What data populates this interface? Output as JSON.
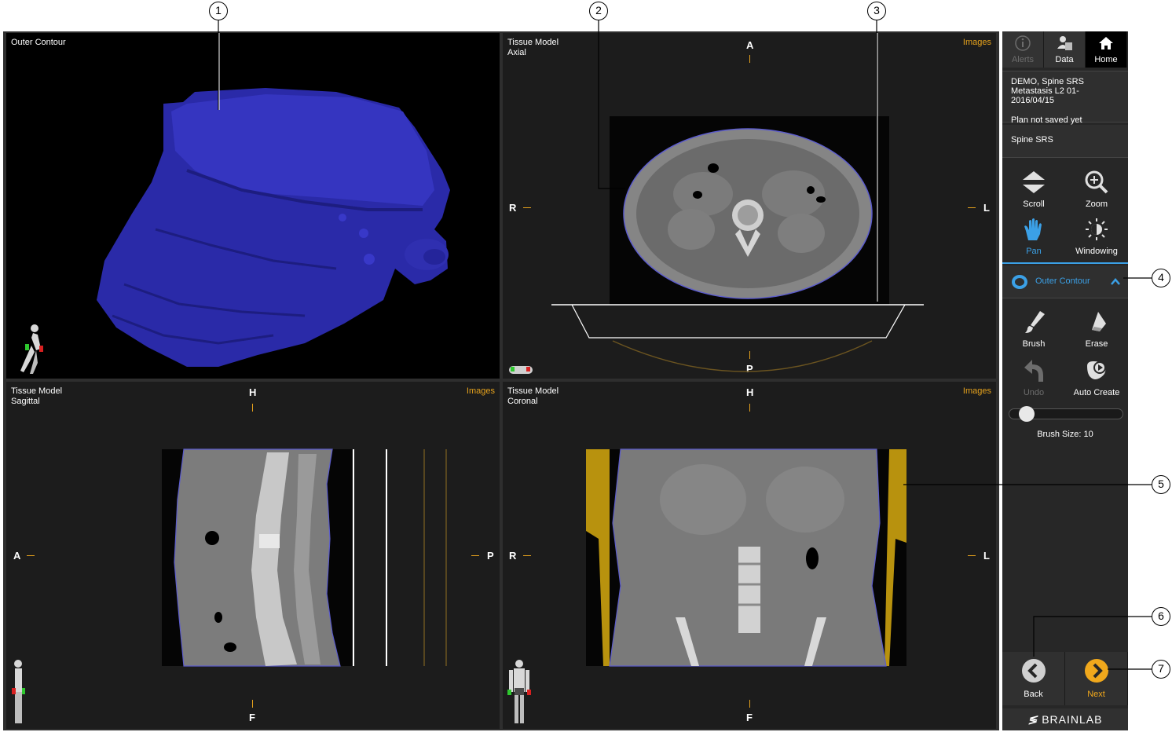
{
  "callouts": [
    "1",
    "2",
    "3",
    "4",
    "5",
    "6",
    "7"
  ],
  "views": {
    "top_left": {
      "title": "Outer Contour"
    },
    "axial": {
      "title": "Tissue Model\nAxial",
      "images": "Images",
      "top": "A",
      "bottom": "P",
      "left": "R",
      "right": "L"
    },
    "sagittal": {
      "title": "Tissue Model\nSagittal",
      "images": "Images",
      "top": "H",
      "bottom": "F",
      "left": "A",
      "right": "P"
    },
    "coronal": {
      "title": "Tissue Model\nCoronal",
      "images": "Images",
      "top": "H",
      "bottom": "F",
      "left": "R",
      "right": "L"
    }
  },
  "sidebar": {
    "tabs": [
      {
        "label": "Alerts",
        "icon": "info-icon",
        "state": "disabled"
      },
      {
        "label": "Data",
        "icon": "data-icon",
        "state": "normal"
      },
      {
        "label": "Home",
        "icon": "home-icon",
        "state": "active"
      }
    ],
    "patient": {
      "line1": "DEMO, Spine SRS",
      "line2": "Metastasis L2 01-2016/04/15",
      "line3": "Plan not saved yet"
    },
    "workflow": "Spine SRS",
    "view_tools": [
      {
        "label": "Scroll",
        "icon": "scroll-icon"
      },
      {
        "label": "Zoom",
        "icon": "zoom-icon"
      },
      {
        "label": "Pan",
        "icon": "pan-hand-icon",
        "state": "active"
      },
      {
        "label": "Windowing",
        "icon": "windowing-icon"
      }
    ],
    "contour": {
      "label": "Outer Contour",
      "icon": "contour-icon"
    },
    "edit_tools": [
      {
        "label": "Brush",
        "icon": "brush-icon"
      },
      {
        "label": "Erase",
        "icon": "eraser-icon"
      },
      {
        "label": "Undo",
        "icon": "undo-icon",
        "state": "disabled"
      },
      {
        "label": "Auto Create",
        "icon": "auto-create-icon"
      }
    ],
    "brush_size_label": "Brush Size: 10",
    "brush_size_value": 10,
    "back_label": "Back",
    "next_label": "Next",
    "brand": "BRAINLAB"
  },
  "colors": {
    "accent_orange": "#e6a21c",
    "accent_blue": "#3ba0e6",
    "model_blue": "#2a2aa8"
  }
}
